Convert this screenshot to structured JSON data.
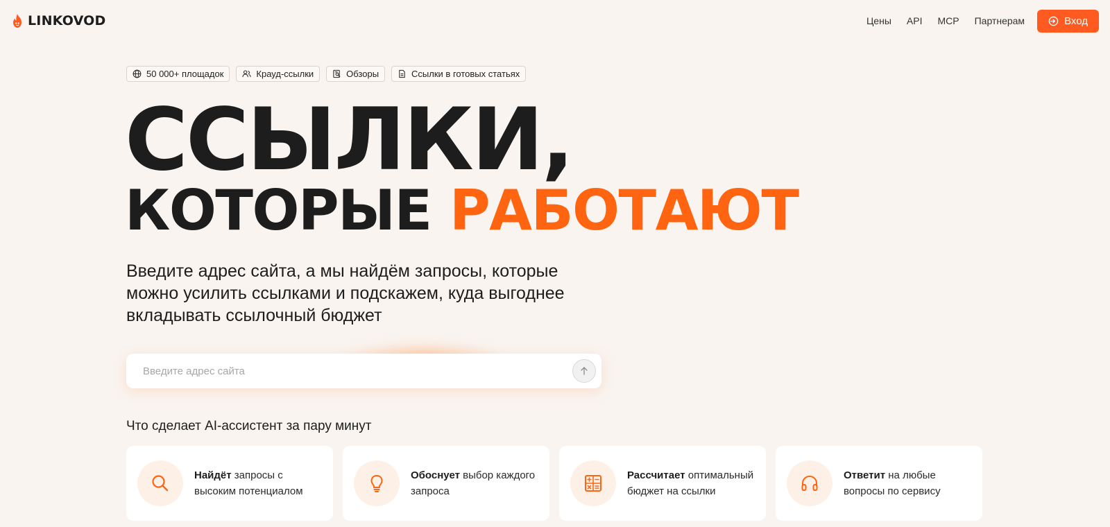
{
  "brand": {
    "name": "LINKOVOD",
    "accent_color": "#ff5a1f",
    "icon": "flame-icon"
  },
  "nav": {
    "links": [
      "Цены",
      "API",
      "MCP",
      "Партнерам"
    ],
    "login_label": "Вход"
  },
  "tags": [
    {
      "icon": "globe-icon",
      "label": "50 000+ площадок"
    },
    {
      "icon": "users-icon",
      "label": "Крауд-ссылки"
    },
    {
      "icon": "review-icon",
      "label": "Обзоры"
    },
    {
      "icon": "document-icon",
      "label": "Ссылки в готовых статьях"
    }
  ],
  "hero": {
    "line1": "ССЫЛКИ,",
    "line2_dark": "КОТОРЫЕ",
    "line2_accent": "РАБОТАЮТ",
    "accent_color": "#ff6410",
    "subtitle": "Введите адрес сайта, а мы найдём запросы, которые можно усилить ссылками и подскажем, куда выгоднее вкладывать ссылочный бюджет"
  },
  "search": {
    "placeholder": "Введите адрес сайта",
    "value": ""
  },
  "features": {
    "title": "Что сделает AI-ассистент за пару минут",
    "cards": [
      {
        "icon": "search-icon",
        "bold": "Найдёт",
        "text": " запросы с высоким потенциалом"
      },
      {
        "icon": "lightbulb-icon",
        "bold": "Обоснует",
        "text": " выбор каждого запроса"
      },
      {
        "icon": "calculator-icon",
        "bold": "Рассчитает",
        "text": " оптимальный бюджет на ссылки"
      },
      {
        "icon": "headphones-icon",
        "bold": "Ответит",
        "text": " на любые вопросы по сервису"
      }
    ]
  }
}
